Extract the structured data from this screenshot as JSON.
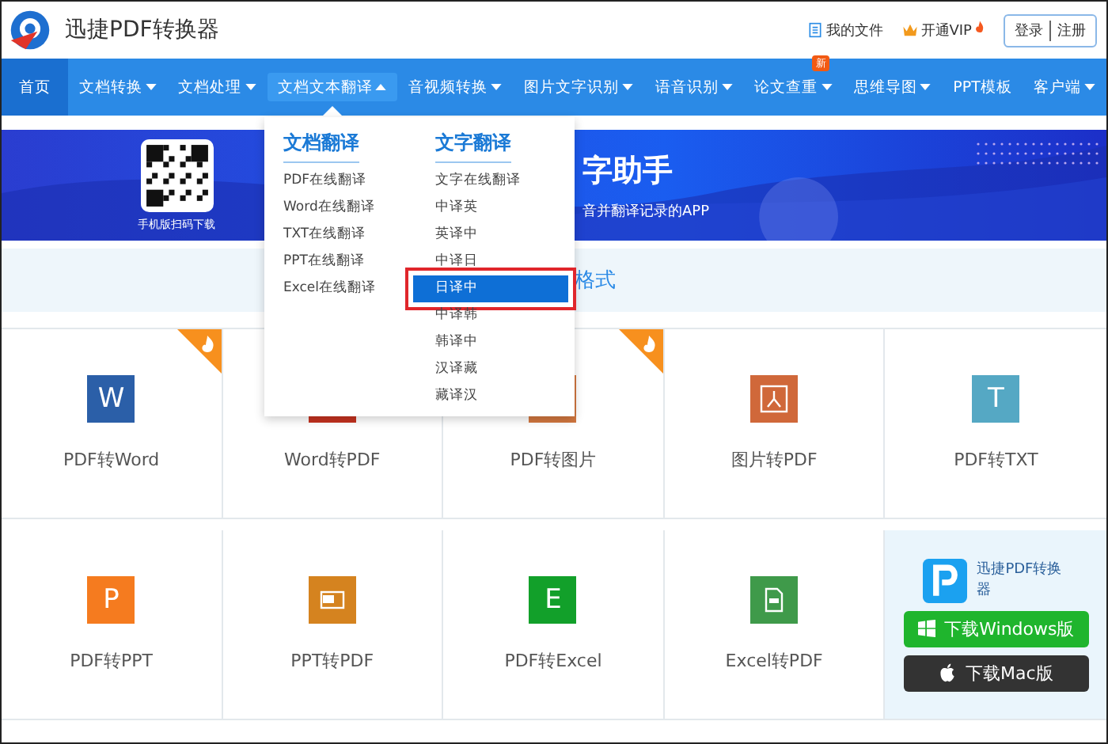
{
  "header": {
    "brand": "迅捷PDF转换器",
    "links": [
      {
        "label": "我的文件",
        "kind": "file"
      },
      {
        "label": "开通VIP",
        "kind": "vip"
      }
    ],
    "auth": [
      "登录",
      "注册"
    ]
  },
  "nav": [
    {
      "label": "首页",
      "kind": "link",
      "expanded": false,
      "selected": true
    },
    {
      "label": "文档转换",
      "kind": "menu",
      "expanded": false,
      "selected": false
    },
    {
      "label": "文档处理",
      "kind": "menu",
      "expanded": false,
      "selected": false
    },
    {
      "label": "文档文本翻译",
      "kind": "menu",
      "expanded": true,
      "selected": false
    },
    {
      "label": "音视频转换",
      "kind": "menu",
      "expanded": false,
      "selected": false
    },
    {
      "label": "图片文字识别",
      "kind": "menu",
      "expanded": false,
      "selected": false
    },
    {
      "label": "语音识别",
      "kind": "menu",
      "expanded": false,
      "selected": false
    },
    {
      "label": "论文查重",
      "kind": "menu",
      "expanded": false,
      "selected": false,
      "badge": "新"
    },
    {
      "label": "思维导图",
      "kind": "menu",
      "expanded": false,
      "selected": false
    },
    {
      "label": "PPT模板",
      "kind": "link",
      "expanded": false,
      "selected": false
    },
    {
      "label": "客户端",
      "kind": "menu",
      "expanded": false,
      "selected": false
    }
  ],
  "dropdown": {
    "columns": [
      {
        "heading": "文档翻译",
        "items": [
          {
            "label": "PDF在线翻译",
            "selected": false,
            "annotated": false
          },
          {
            "label": "Word在线翻译",
            "selected": false,
            "annotated": false
          },
          {
            "label": "TXT在线翻译",
            "selected": false,
            "annotated": false
          },
          {
            "label": "PPT在线翻译",
            "selected": false,
            "annotated": false
          },
          {
            "label": "Excel在线翻译",
            "selected": false,
            "annotated": false
          }
        ]
      },
      {
        "heading": "文字翻译",
        "items": [
          {
            "label": "文字在线翻译",
            "selected": false,
            "annotated": false
          },
          {
            "label": "中译英",
            "selected": false,
            "annotated": false
          },
          {
            "label": "英译中",
            "selected": false,
            "annotated": false
          },
          {
            "label": "中译日",
            "selected": false,
            "annotated": false
          },
          {
            "label": "日译中",
            "selected": true,
            "annotated": true
          },
          {
            "label": "中译韩",
            "selected": false,
            "annotated": false
          },
          {
            "label": "韩译中",
            "selected": false,
            "annotated": false
          },
          {
            "label": "汉译藏",
            "selected": false,
            "annotated": false
          },
          {
            "label": "藏译汉",
            "selected": false,
            "annotated": false
          }
        ]
      }
    ]
  },
  "banner": {
    "qr_caption": "手机版扫码下载",
    "title": "字助手",
    "subtitle": "音并翻译记录的APP"
  },
  "strip": {
    "text": "格式"
  },
  "tools": [
    {
      "label": "PDF转Word",
      "kind": "letter",
      "glyph": "W",
      "color": "#2b5fa8",
      "hot": true
    },
    {
      "label": "Word转PDF",
      "kind": "plain",
      "color": "#c4321f",
      "hot": false
    },
    {
      "label": "PDF转图片",
      "kind": "plain",
      "color": "#d2773f",
      "hot": true
    },
    {
      "label": "图片转PDF",
      "kind": "acrobat",
      "color": "#d0683a",
      "hot": false
    },
    {
      "label": "PDF转TXT",
      "kind": "letter",
      "glyph": "T",
      "color": "#55a8c4",
      "hot": false
    },
    {
      "label": "PDF转PPT",
      "kind": "letter",
      "glyph": "P",
      "color": "#f57b1f",
      "hot": false
    },
    {
      "label": "PPT转PDF",
      "kind": "slide",
      "color": "#d5831f",
      "hot": false
    },
    {
      "label": "PDF转Excel",
      "kind": "letter",
      "glyph": "E",
      "color": "#12a02a",
      "hot": false
    },
    {
      "label": "Excel转PDF",
      "kind": "doc",
      "color": "#3f9a4a",
      "hot": false
    }
  ],
  "download": {
    "app_name": "迅捷PDF转换器",
    "buttons": [
      {
        "label": "下载Windows版",
        "kind": "windows"
      },
      {
        "label": "下载Mac版",
        "kind": "mac"
      }
    ]
  }
}
